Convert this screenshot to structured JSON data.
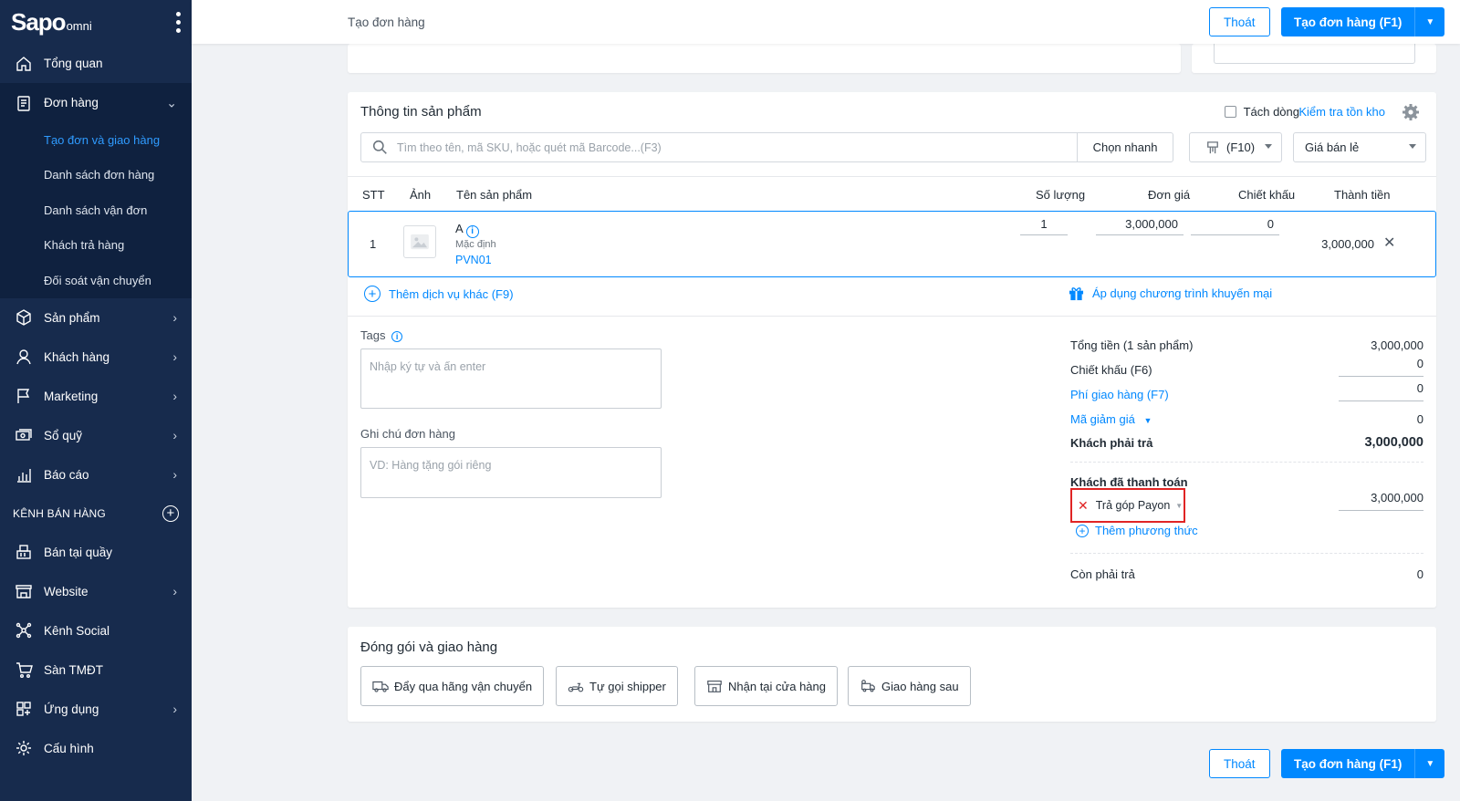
{
  "brand": {
    "logo": "Sapo",
    "logo_suffix": "omni"
  },
  "sidebar": {
    "items": [
      {
        "label": "Tổng quan",
        "icon": "home-icon"
      },
      {
        "label": "Đơn hàng",
        "icon": "order-icon"
      },
      {
        "label": "Sản phẩm",
        "icon": "box-icon"
      },
      {
        "label": "Khách hàng",
        "icon": "user-icon"
      },
      {
        "label": "Marketing",
        "icon": "flag-icon"
      },
      {
        "label": "Sổ quỹ",
        "icon": "cash-icon"
      },
      {
        "label": "Báo cáo",
        "icon": "chart-icon"
      }
    ],
    "order_sub": [
      "Tạo đơn và giao hàng",
      "Danh sách đơn hàng",
      "Danh sách vận đơn",
      "Khách trả hàng",
      "Đối soát vận chuyển"
    ],
    "section_title": "KÊNH BÁN HÀNG",
    "channels": [
      {
        "label": "Bán tại quầy",
        "icon": "pos-icon"
      },
      {
        "label": "Website",
        "icon": "store-icon"
      },
      {
        "label": "Kênh Social",
        "icon": "social-icon"
      },
      {
        "label": "Sàn TMĐT",
        "icon": "ecommerce-icon"
      },
      {
        "label": "Ứng dụng",
        "icon": "apps-icon"
      },
      {
        "label": "Cấu hình",
        "icon": "settings-icon"
      }
    ]
  },
  "topbar": {
    "title": "Tạo đơn hàng",
    "exit": "Thoát",
    "create": "Tạo đơn hàng (F1)"
  },
  "product": {
    "title": "Thông tin sản phẩm",
    "split_line": "Tách dòng",
    "check_stock": "Kiểm tra tồn kho",
    "search_placeholder": "Tìm theo tên, mã SKU, hoặc quét mã Barcode...(F3)",
    "quick_pick": "Chọn nhanh",
    "f10": "(F10)",
    "price_type": "Giá bán lẻ",
    "columns": {
      "stt": "STT",
      "image": "Ảnh",
      "name": "Tên sản phẩm",
      "qty": "Số lượng",
      "price": "Đơn giá",
      "discount": "Chiết khấu",
      "total": "Thành tiền"
    },
    "row": {
      "stt": "1",
      "name": "A",
      "variant": "Mặc định",
      "sku": "PVN01",
      "qty": "1",
      "price": "3,000,000",
      "discount": "0",
      "total": "3,000,000"
    },
    "add_service": "Thêm dịch vụ khác (F9)",
    "apply_promo": "Áp dụng chương trình khuyến mại"
  },
  "notes": {
    "tags_label": "Tags",
    "tags_placeholder": "Nhập ký tự và ấn enter",
    "note_label": "Ghi chú đơn hàng",
    "note_placeholder": "VD: Hàng tặng gói riêng"
  },
  "summary": {
    "total_label": "Tổng tiền (1 sản phẩm)",
    "total_value": "3,000,000",
    "discount_label": "Chiết khấu (F6)",
    "discount_value": "0",
    "shipping_label": "Phí giao hàng (F7)",
    "shipping_value": "0",
    "coupon_label": "Mã giảm giá",
    "coupon_value": "0",
    "must_pay_label": "Khách phải trả",
    "must_pay_value": "3,000,000",
    "paid_label": "Khách đã thanh toán",
    "payment_method": "Trả góp Payon",
    "payment_value": "3,000,000",
    "add_method": "Thêm phương thức",
    "remaining_label": "Còn phải trả",
    "remaining_value": "0"
  },
  "shipping": {
    "title": "Đóng gói và giao hàng",
    "options": [
      "Đẩy qua hãng vận chuyển",
      "Tự gọi shipper",
      "Nhận tại cửa hàng",
      "Giao hàng sau"
    ]
  },
  "colors": {
    "sidebar": "#172b4d",
    "primary": "#0088ff",
    "highlight": "#e02424"
  }
}
